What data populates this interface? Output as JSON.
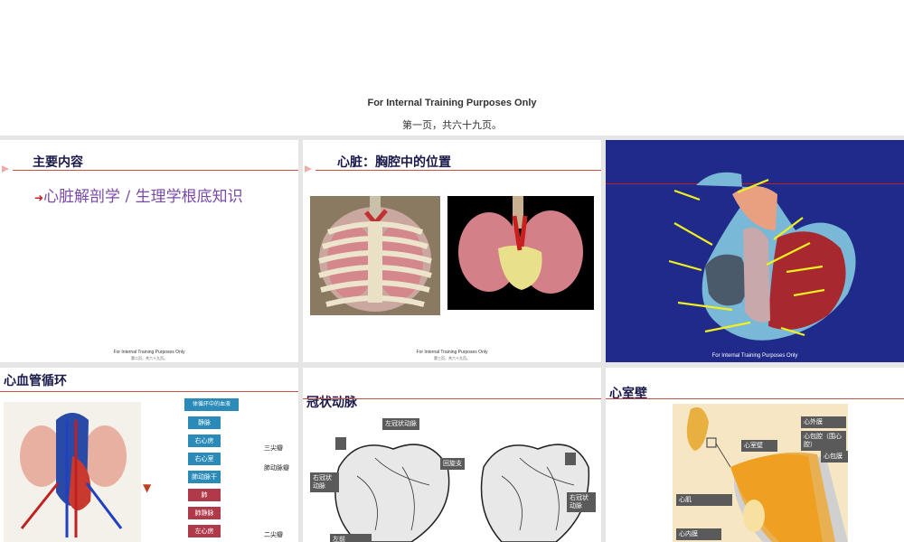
{
  "header": {
    "line1": "For Internal Training Purposes Only",
    "line2": "第一页，共六十九页。"
  },
  "slide1": {
    "title": "主要内容",
    "bullet": "心脏解剖学 / 生理学根底知识",
    "footer1": "For Internal Training Purposes Only",
    "footer2": "第二页，共六十九页。"
  },
  "slide2": {
    "title": "心脏：胸腔中的位置",
    "footer1": "For Internal Training Purposes Only",
    "footer2": "第三页，共六十九页。"
  },
  "slide3": {
    "footer": "For Internal Training Purposes Only"
  },
  "slide4": {
    "title": "心血管循环",
    "flow": [
      "体循环中的血液",
      "静脉",
      "右心房",
      "右心室",
      "肺动脉干",
      "肺",
      "肺静脉",
      "左心房"
    ],
    "valves": [
      "三尖瓣",
      "肺动脉瓣",
      "二尖瓣"
    ]
  },
  "slide5": {
    "title": "冠状动脉",
    "labels": [
      "左冠状动脉",
      "回旋支",
      "右冠状动脉",
      "右冠状动脉",
      "左前"
    ]
  },
  "slide6": {
    "title": "心室壁",
    "labels": [
      "心外膜",
      "心包腔（围心腔）",
      "心包膜",
      "心室壁",
      "心肌",
      "心内膜"
    ]
  },
  "colors": {
    "title": "#1a1a4a",
    "bullet": "#7a4aa8",
    "accent_line": "#c8504a",
    "slide3_background": "#1f2a8a",
    "flow_blue": "#2a8ab8",
    "flow_red": "#b03a4a"
  }
}
